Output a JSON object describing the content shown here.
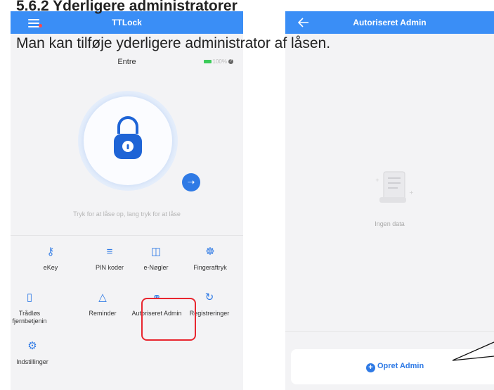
{
  "document": {
    "heading": "5.6.2 Yderligere administratorer",
    "body": "Man kan tilføje yderligere administrator af låsen."
  },
  "screen_left": {
    "app_title": "TTLock",
    "lock_name": "Entre",
    "battery": "100%",
    "hint": "Tryk for at låse op, lang tryk for at låse",
    "menu_items": [
      {
        "label": "eKey",
        "icon": "ekey-icon"
      },
      {
        "label": "PIN koder",
        "icon": "pin-code-icon"
      },
      {
        "label": "e-Nøgler",
        "icon": "card-icon"
      },
      {
        "label": "Fingeraftryk",
        "icon": "fingerprint-icon"
      },
      {
        "label": "Trådløs fjernbetjenin",
        "icon": "remote-icon"
      },
      {
        "label": "Reminder",
        "icon": "bell-icon"
      },
      {
        "label": "Autoriseret Admin",
        "icon": "admin-icon"
      },
      {
        "label": "Registreringer",
        "icon": "history-icon"
      },
      {
        "label": "Indstillinger",
        "icon": "gear-icon"
      }
    ]
  },
  "screen_right": {
    "title": "Autoriseret Admin",
    "empty_text": "Ingen data",
    "create_button": "Opret Admin"
  },
  "colors": {
    "primary": "#3a8ef6",
    "highlight": "#e8262f"
  }
}
